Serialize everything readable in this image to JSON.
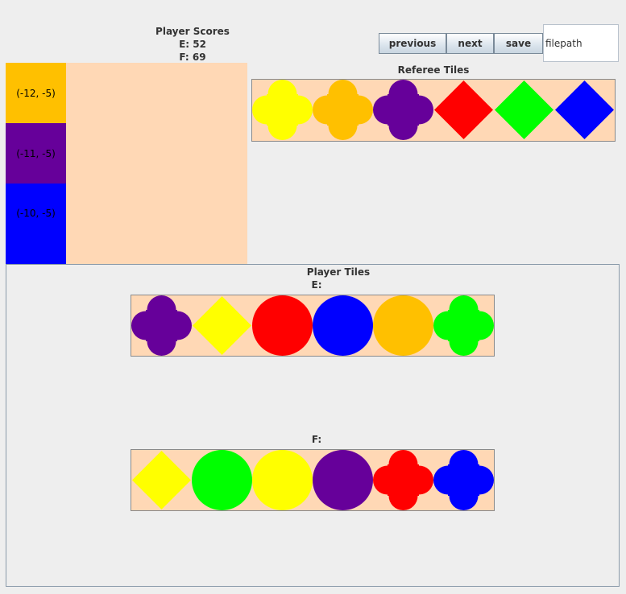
{
  "scores": {
    "title": "Player Scores",
    "e_line": "E: 52",
    "f_line": "F: 69"
  },
  "colors": {
    "background": "#eeeeee",
    "board": "#ffd8b5",
    "yellow": "#ffff00",
    "orange": "#ffc000",
    "purple": "#66009a",
    "red": "#ff0000",
    "green": "#00ff00",
    "blue": "#0000ff"
  },
  "board": {
    "tiles": [
      {
        "label": "(-12, -5)",
        "color": "#ffc000"
      },
      {
        "label": "(-11, -5)",
        "color": "#66009a"
      },
      {
        "label": "(-10, -5)",
        "color": "#0000ff"
      }
    ]
  },
  "toolbar": {
    "previous_label": "previous",
    "next_label": "next",
    "save_label": "save",
    "filepath_value": "filepath"
  },
  "referee": {
    "title": "Referee Tiles",
    "tiles": [
      {
        "shape": "clover",
        "color": "#ffff00"
      },
      {
        "shape": "clover",
        "color": "#ffc000"
      },
      {
        "shape": "clover",
        "color": "#66009a"
      },
      {
        "shape": "diamond",
        "color": "#ff0000"
      },
      {
        "shape": "diamond",
        "color": "#00ff00"
      },
      {
        "shape": "diamond",
        "color": "#0000ff"
      }
    ]
  },
  "players": {
    "title": "Player Tiles",
    "e": {
      "label": "E:",
      "tiles": [
        {
          "shape": "clover",
          "color": "#66009a"
        },
        {
          "shape": "diamond",
          "color": "#ffff00"
        },
        {
          "shape": "circle",
          "color": "#ff0000"
        },
        {
          "shape": "circle",
          "color": "#0000ff"
        },
        {
          "shape": "circle",
          "color": "#ffc000"
        },
        {
          "shape": "clover",
          "color": "#00ff00"
        }
      ]
    },
    "f": {
      "label": "F:",
      "tiles": [
        {
          "shape": "diamond",
          "color": "#ffff00"
        },
        {
          "shape": "circle",
          "color": "#00ff00"
        },
        {
          "shape": "circle",
          "color": "#ffff00"
        },
        {
          "shape": "circle",
          "color": "#66009a"
        },
        {
          "shape": "clover",
          "color": "#ff0000"
        },
        {
          "shape": "clover",
          "color": "#0000ff"
        }
      ]
    }
  }
}
